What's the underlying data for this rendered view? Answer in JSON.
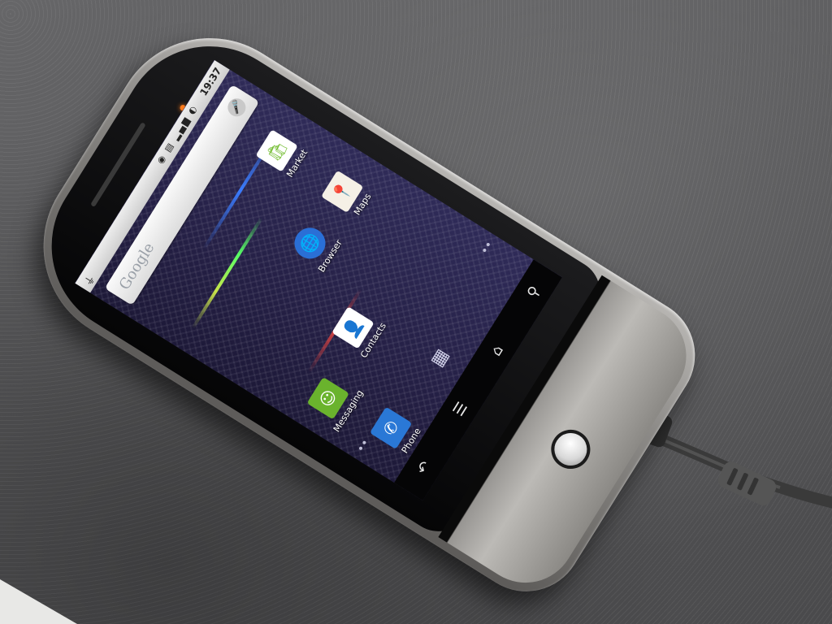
{
  "scene": {
    "description_hidden": ""
  },
  "status_bar": {
    "usb_icon": "usb-icon",
    "icons": "◉ ▤ ▂▄▆ ◐",
    "time": "19:37"
  },
  "search_widget": {
    "brand": "Google",
    "mic_icon": "mic-icon"
  },
  "apps": [
    {
      "label": "Market",
      "icon": "market-icon",
      "color": "#ffffff"
    },
    {
      "label": "Maps",
      "icon": "maps-icon",
      "color": "#ffffff"
    },
    {
      "label": "Browser",
      "icon": "browser-icon",
      "color": "#2a6fd6"
    },
    {
      "label": "Messaging",
      "icon": "messaging-icon",
      "color": "#6ab32d"
    },
    {
      "label": "Contacts",
      "icon": "contacts-icon",
      "color": "#ffffff"
    },
    {
      "label": "Phone",
      "icon": "phone-icon",
      "color": "#2a78d6"
    }
  ],
  "softkeys": {
    "back": "↶",
    "menu": "☰",
    "home": "⌂",
    "search": "⚲"
  },
  "colors": {
    "screen_bg": "#2a2550",
    "led": "#ff7a1a",
    "phone_body": "#8c8a87"
  }
}
